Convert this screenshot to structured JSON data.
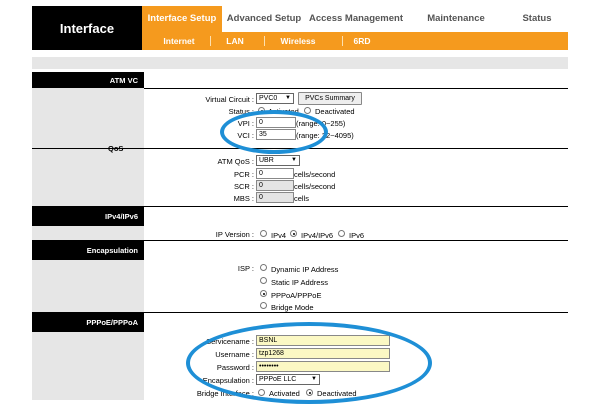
{
  "header": {
    "brand": "Interface",
    "nav": [
      {
        "label": "Interface Setup",
        "active": true
      },
      {
        "label": "Advanced Setup",
        "active": false
      },
      {
        "label": "Access Management",
        "active": false
      },
      {
        "label": "Maintenance",
        "active": false
      },
      {
        "label": "Status",
        "active": false
      }
    ],
    "subnav": [
      "Internet",
      "LAN",
      "Wireless",
      "6RD"
    ]
  },
  "sections": {
    "atm_vc": "ATM VC",
    "qos": "QoS",
    "ipv4_ipv6": "IPv4/IPv6",
    "encapsulation": "Encapsulation",
    "pppoe_pppoa": "PPPoE/PPPoA"
  },
  "atm": {
    "vc_label": "Virtual Circuit :",
    "vc_value": "PVC0",
    "pvcs_button": "PVCs Summary",
    "status_label": "Status :",
    "status_activated": "Activated",
    "status_deactivated": "Deactivated",
    "vpi_label": "VPI :",
    "vpi_value": "0",
    "vpi_range": "(range: 0~255)",
    "vci_label": "VCI :",
    "vci_value": "35",
    "vci_range": "(range: 32~4095)"
  },
  "qos": {
    "atm_qos_label": "ATM QoS :",
    "atm_qos_value": "UBR",
    "pcr_label": "PCR :",
    "pcr_value": "0",
    "scr_label": "SCR :",
    "scr_value": "0",
    "mbs_label": "MBS :",
    "mbs_value": "0",
    "cells_per_second": "cells/second",
    "cells": "cells"
  },
  "ip_version": {
    "label": "IP Version :",
    "options": [
      "IPv4",
      "IPv4/IPv6",
      "IPv6"
    ],
    "selected": "IPv4/IPv6"
  },
  "isp": {
    "label": "ISP :",
    "options": [
      "Dynamic IP Address",
      "Static IP Address",
      "PPPoA/PPPoE",
      "Bridge Mode"
    ],
    "selected": "PPPoA/PPPoE"
  },
  "pppoe": {
    "servicename_label": "Servicename :",
    "servicename_value": "BSNL",
    "username_label": "Username :",
    "username_value": "tzp1268",
    "password_label": "Password :",
    "password_value": "••••••••",
    "encapsulation_label": "Encapsulation :",
    "encapsulation_value": "PPPoE LLC",
    "bridge_label": "Bridge Interface :",
    "bridge_activated": "Activated",
    "bridge_deactivated": "Deactivated"
  },
  "colors": {
    "accent": "#f59a1e",
    "highlight_ellipse": "#1e8fd6",
    "panel_gray": "#e6e6e6",
    "field_yellow": "#fbf8c4"
  }
}
